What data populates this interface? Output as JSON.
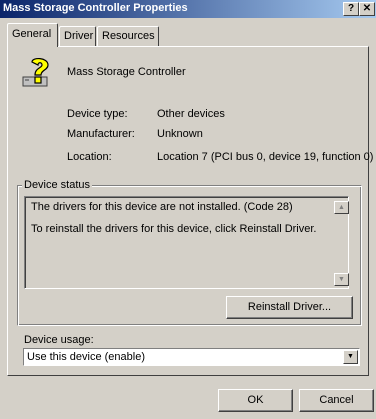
{
  "window": {
    "title": "Mass Storage Controller Properties",
    "help_glyph": "?",
    "close_glyph": "✕"
  },
  "tabs": [
    {
      "label": "General",
      "active": true
    },
    {
      "label": "Driver",
      "active": false
    },
    {
      "label": "Resources",
      "active": false
    }
  ],
  "device": {
    "icon": "unknown-device-question-icon",
    "name": "Mass Storage Controller",
    "properties": [
      {
        "label": "Device type:",
        "value": "Other devices"
      },
      {
        "label": "Manufacturer:",
        "value": "Unknown"
      },
      {
        "label": "Location:",
        "value": "Location 7 (PCI bus 0, device 19, function 0)"
      }
    ]
  },
  "status": {
    "group_title": "Device status",
    "line1": "The drivers for this device are not installed. (Code 28)",
    "line2": "To reinstall the drivers for this device, click Reinstall Driver.",
    "button": "Reinstall Driver..."
  },
  "usage": {
    "label": "Device usage:",
    "selected": "Use this device (enable)"
  },
  "footer": {
    "ok": "OK",
    "cancel": "Cancel"
  }
}
